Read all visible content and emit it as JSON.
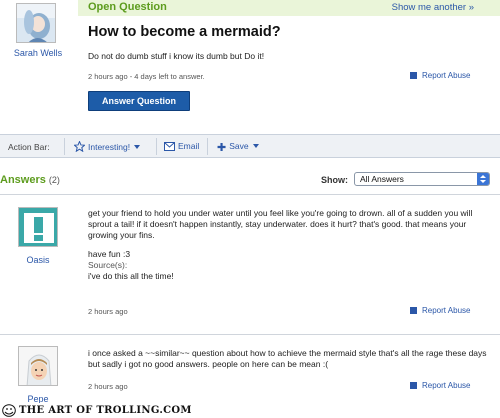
{
  "question": {
    "status": "Open Question",
    "show_more": "Show me another »",
    "author": "Sarah Wells",
    "title": "How to become a mermaid?",
    "body": "Do not do dumb stuff i know its dumb but Do it!",
    "meta": "2 hours ago - 4 days left to answer.",
    "report_abuse": "Report Abuse",
    "answer_button": "Answer Question"
  },
  "action_bar": {
    "label": "Action Bar:",
    "interesting": "Interesting!",
    "email": "Email",
    "save": "Save"
  },
  "answers_header": {
    "title": "Answers",
    "count": "(2)",
    "show_label": "Show:",
    "filter_selected": "All Answers"
  },
  "answers": [
    {
      "author": "Oasis",
      "text": "get your friend to hold you under water until you feel like you're going to drown. all of a sudden you will sprout a tail! if it doesn't happen instantly, stay underwater. does it hurt? that's good. that means your growing your fins.",
      "have_fun": "have fun :3",
      "sources_label": "Source(s):",
      "sources": "i've do this all the time!",
      "meta": "2 hours ago",
      "report_abuse": "Report Abuse"
    },
    {
      "author": "Pepe",
      "text": "i once asked a ~~similar~~ question about how to achieve the mermaid style that's all the rage these days but sadly i got no good answers. people on here can be mean :(",
      "meta": "2 hours ago",
      "report_abuse": "Report Abuse"
    }
  ],
  "watermark": "THE ART OF TROLLING.COM",
  "colors": {
    "accent_green": "#5d9c1e",
    "link_blue": "#2b57a8",
    "button_blue": "#1d5ca8",
    "header_bg": "#eaf5d9",
    "action_bar_bg": "#eef1f5"
  },
  "icons": [
    "star-icon",
    "email-icon",
    "save-plus-icon",
    "flag-icon",
    "dropdown-caret-icon",
    "trollface-icon"
  ]
}
